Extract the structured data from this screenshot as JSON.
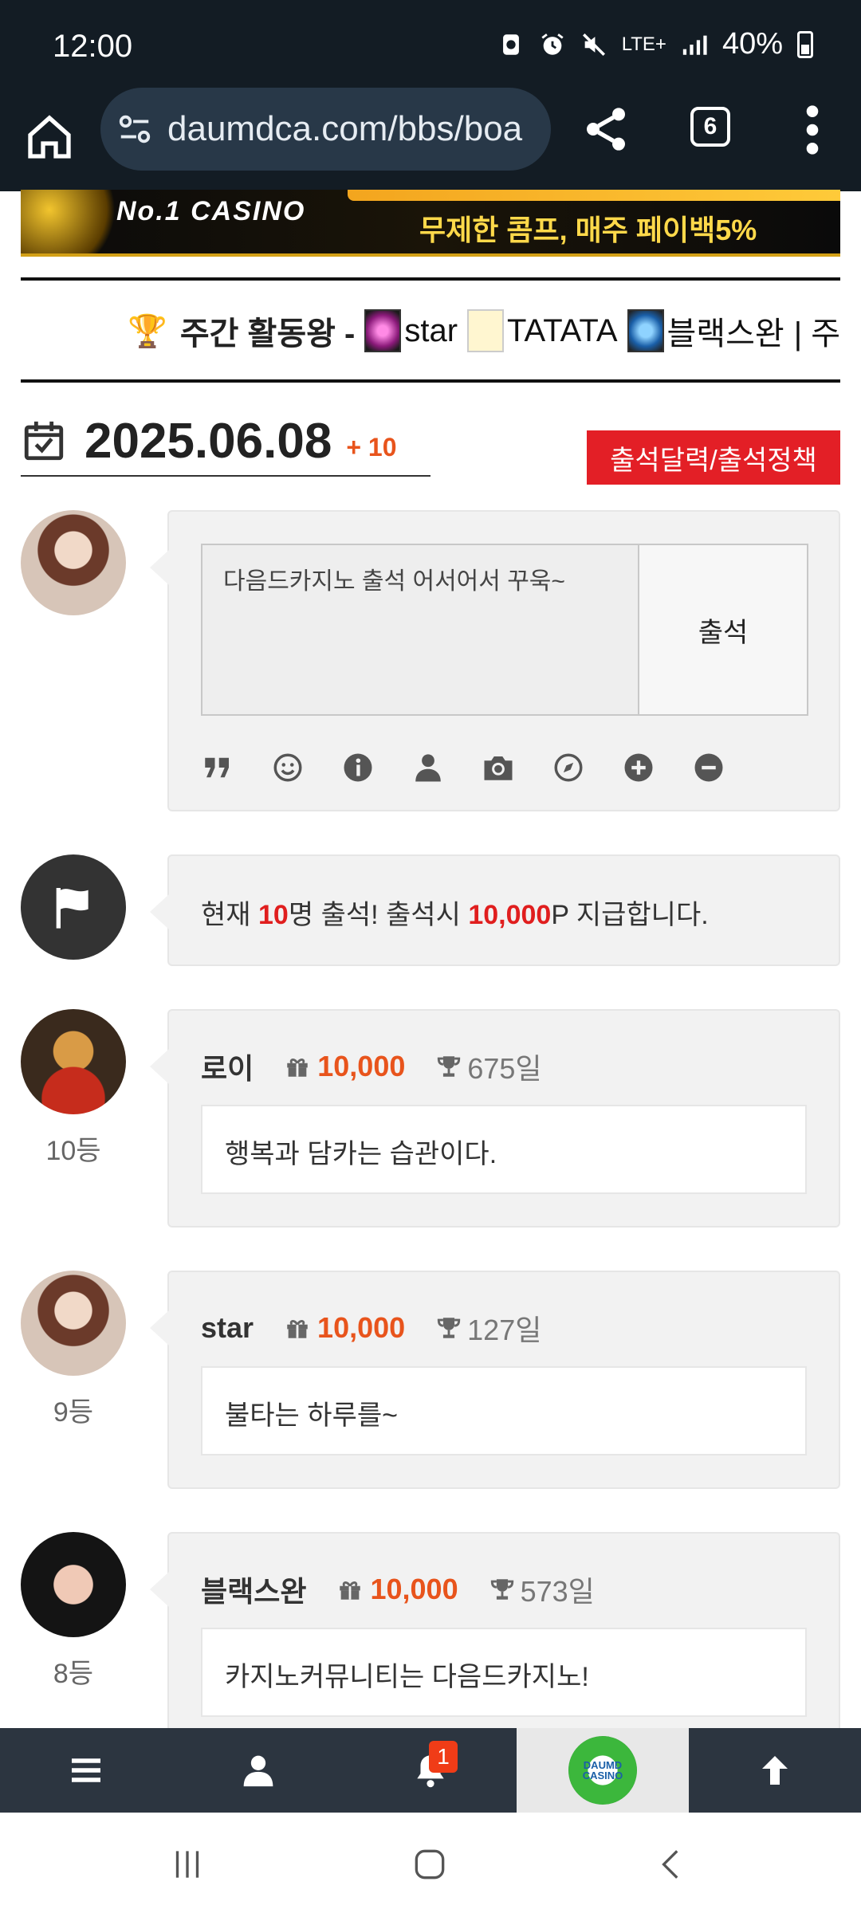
{
  "status_bar": {
    "time": "12:00",
    "network": "LTE+",
    "battery": "40%"
  },
  "browser": {
    "url": "daumdca.com/bbs/boa",
    "tab_count": "6"
  },
  "banner": {
    "left_text": "No.1 CASINO",
    "right_text": "무제한 콤프, 매주 페이백5%"
  },
  "weekly": {
    "title": "주간 활동왕 -",
    "users": [
      "star",
      "TATATA",
      "블랙스완"
    ],
    "separator": "| 주"
  },
  "date_header": {
    "date": "2025.06.08",
    "plus": "+ 10",
    "policy_button": "출석달력/출석정책"
  },
  "compose": {
    "text": "다음드카지노 출석 어서어서 꾸욱~",
    "submit_label": "출석"
  },
  "notice": {
    "prefix": "현재 ",
    "count": "10",
    "mid": "명 출석! 출석시 ",
    "points": "10,000",
    "suffix": "P 지급합니다."
  },
  "posts": [
    {
      "name": "로이",
      "points": "10,000",
      "days": "675일",
      "rank": "10등",
      "message": "행복과 담카는 습관이다."
    },
    {
      "name": "star",
      "points": "10,000",
      "days": "127일",
      "rank": "9등",
      "message": "불타는 하루를~"
    },
    {
      "name": "블랙스완",
      "points": "10,000",
      "days": "573일",
      "rank": "8등",
      "message": "카지노커뮤니티는 다음드카지노!"
    }
  ],
  "bottom_nav": {
    "notification_count": "1",
    "logo_text": "DAUMD CASINO"
  },
  "colors": {
    "accent_red": "#e31f26",
    "points_orange": "#e8541c",
    "nav_dark": "#2c3540",
    "browser_dark": "#131c24"
  }
}
